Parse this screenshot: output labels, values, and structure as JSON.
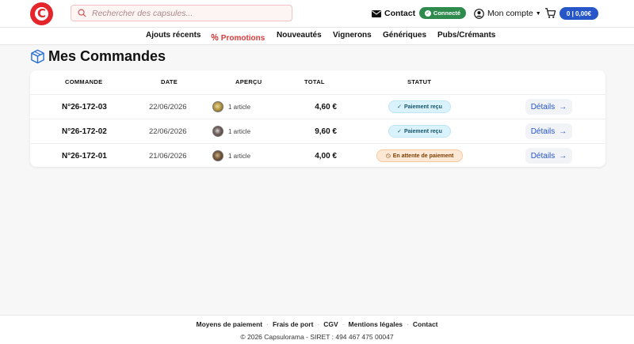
{
  "header": {
    "search_placeholder": "Rechercher des capsules...",
    "contact": "Contact",
    "connected": "Connecté",
    "account": "Mon compte",
    "cart": "0 | 0,00€"
  },
  "nav": {
    "items": [
      "Ajouts récents",
      "Promotions",
      "Nouveautés",
      "Vignerons",
      "Génériques",
      "Pubs/Crémants"
    ]
  },
  "page": {
    "title": "Mes Commandes"
  },
  "table": {
    "columns": [
      "COMMANDE",
      "DATE",
      "APERÇU",
      "TOTAL",
      "STATUT"
    ],
    "rows": [
      {
        "order": "N°26-172-03",
        "date": "22/06/2026",
        "preview": "1 article",
        "total": "4,60 €",
        "status": "Paiement reçu",
        "action": "Détails"
      },
      {
        "order": "N°26-172-02",
        "date": "22/06/2026",
        "preview": "1 article",
        "total": "9,60 €",
        "status": "Paiement reçu",
        "action": "Détails"
      },
      {
        "order": "N°26-172-01",
        "date": "21/06/2026",
        "preview": "1 article",
        "total": "4,00 €",
        "status": "En attente de paiement",
        "action": "Détails"
      }
    ]
  },
  "footer": {
    "links": [
      "Moyens de paiement",
      "Frais de port",
      "CGV",
      "Mentions légales",
      "Contact"
    ],
    "copyright": "© 2026 Capsulorama - SIRET : 494 467 475 00047"
  },
  "colors": {
    "brand": "#e4262b",
    "accent": "#2656c8",
    "connected": "#2f8a4e"
  }
}
